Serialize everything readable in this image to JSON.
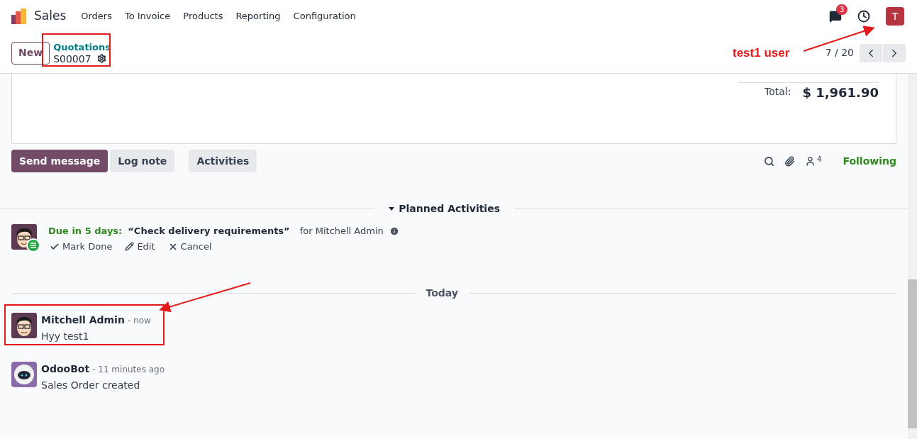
{
  "navbar": {
    "app_name": "Sales",
    "menu": [
      {
        "label": "Orders"
      },
      {
        "label": "To Invoice"
      },
      {
        "label": "Products"
      },
      {
        "label": "Reporting"
      },
      {
        "label": "Configuration"
      }
    ],
    "messages_badge": "3",
    "user_initial": "T"
  },
  "control_panel": {
    "new_button": "New",
    "breadcrumb": "Quotations",
    "record_name": "S00007",
    "pager": "7 / 20"
  },
  "totals": {
    "label": "Total:",
    "value": "$ 1,961.90"
  },
  "chatter": {
    "buttons": [
      {
        "label": "Send message",
        "selected": true
      },
      {
        "label": "Log note",
        "selected": false
      },
      {
        "label": "Activities",
        "selected": false
      }
    ],
    "followers_count": "4",
    "follow_state": "Following"
  },
  "planned_activities": {
    "title": "Planned Activities",
    "activities": [
      {
        "due": "Due in 5 days:",
        "summary": "“Check delivery requirements”",
        "assignee": "for Mitchell Admin",
        "actions": [
          {
            "kind": "done",
            "label": "Mark Done"
          },
          {
            "kind": "edit",
            "label": "Edit"
          },
          {
            "kind": "cancel",
            "label": "Cancel"
          }
        ]
      }
    ]
  },
  "day_separator": "Today",
  "messages": [
    {
      "author": "Mitchell Admin",
      "time": "- now",
      "body": "Hyy test1",
      "kind": "person"
    },
    {
      "author": "OdooBot",
      "time": "- 11 minutes ago",
      "body": "Sales Order created",
      "kind": "bot"
    }
  ],
  "annotations": {
    "user_label": "test1 user"
  }
}
